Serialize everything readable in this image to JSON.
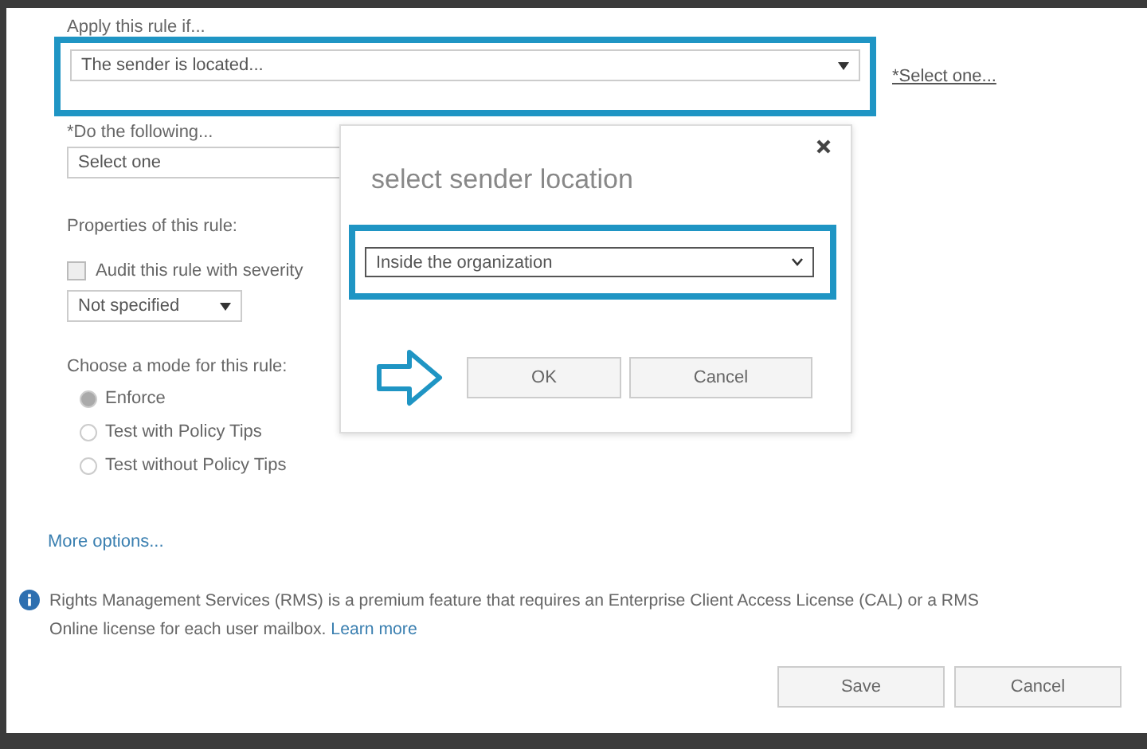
{
  "rule_form": {
    "condition_label": "Apply this rule if...",
    "condition_select": {
      "value": "The sender is located...",
      "highlighted": true
    },
    "condition_link": "*Select one...",
    "action_label": "*Do the following...",
    "action_select": {
      "value": "Select one"
    },
    "properties_label": "Properties of this rule:",
    "audit": {
      "label": "Audit this rule with severity",
      "checked": false
    },
    "severity_select": {
      "value": "Not specified"
    },
    "mode_label": "Choose a mode for this rule:",
    "modes": [
      {
        "label": "Enforce",
        "selected": true
      },
      {
        "label": "Test with Policy Tips",
        "selected": false
      },
      {
        "label": "Test without Policy Tips",
        "selected": false
      }
    ],
    "more_options": "More options..."
  },
  "info": {
    "lines": [
      "Rights Management Services (RMS) is a premium feature that requires an Enterprise Client Access License (CAL) or a RMS",
      "Online license for each user mailbox."
    ],
    "link": "Learn more"
  },
  "buttons": [
    "Save",
    "Cancel"
  ],
  "dialog": {
    "title": "select sender location",
    "select": {
      "value": "Inside the organization",
      "highlighted": true
    },
    "buttons": [
      "OK",
      "Cancel"
    ]
  }
}
